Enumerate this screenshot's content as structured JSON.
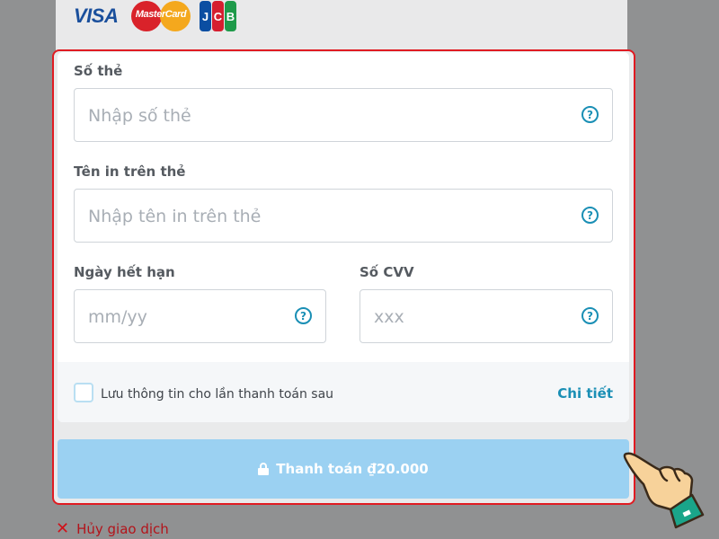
{
  "card_logos": {
    "visa": "VISA",
    "mastercard": "MasterCard",
    "jcb": [
      "J",
      "C",
      "B"
    ]
  },
  "form": {
    "card_number": {
      "label": "Số thẻ",
      "placeholder": "Nhập số thẻ"
    },
    "card_name": {
      "label": "Tên in trên thẻ",
      "placeholder": "Nhập tên in trên thẻ"
    },
    "expiry": {
      "label": "Ngày hết hạn",
      "placeholder": "mm/yy"
    },
    "cvv": {
      "label": "Số CVV",
      "placeholder": "xxx"
    },
    "help_glyph": "?"
  },
  "save_info": {
    "checked": false,
    "label": "Lưu thông tin cho lần thanh toán sau",
    "detail_link": "Chi tiết"
  },
  "pay_button": {
    "label": "Thanh toán ₫20.000"
  },
  "cancel": {
    "glyph": "✕",
    "label": "Hủy giao dịch"
  },
  "colors": {
    "accent": "#1a8fb5",
    "pay_button": "#9bd1f2",
    "highlight_border": "#e01b22",
    "cancel": "#b3141b"
  },
  "icons": [
    "lock-icon",
    "help-icon",
    "close-icon",
    "pointing-hand-icon"
  ]
}
